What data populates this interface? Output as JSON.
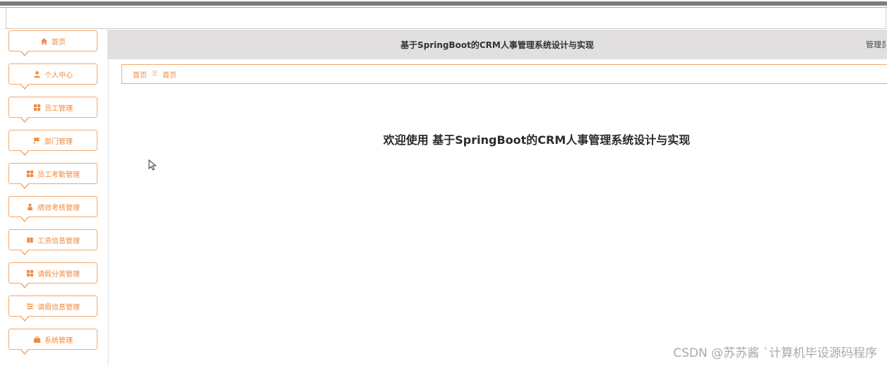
{
  "sidebar": {
    "items": [
      {
        "label": "首页",
        "icon": "home-icon"
      },
      {
        "label": "个人中心",
        "icon": "user-icon"
      },
      {
        "label": "员工管理",
        "icon": "grid-icon"
      },
      {
        "label": "部门管理",
        "icon": "flag-icon"
      },
      {
        "label": "员工考勤管理",
        "icon": "grid-icon"
      },
      {
        "label": "绩效考核管理",
        "icon": "person-icon"
      },
      {
        "label": "工资信息管理",
        "icon": "book-icon"
      },
      {
        "label": "请假分类管理",
        "icon": "grid-icon"
      },
      {
        "label": "请假信息管理",
        "icon": "sliders-icon"
      },
      {
        "label": "系统管理",
        "icon": "briefcase-icon"
      }
    ]
  },
  "header": {
    "title": "基于SpringBoot的CRM人事管理系统设计与实现",
    "user": "管理员"
  },
  "breadcrumb": {
    "home": "首页",
    "separator": "☰",
    "current": "首页"
  },
  "main": {
    "welcome": "欢迎使用 基于SpringBoot的CRM人事管理系统设计与实现"
  },
  "watermark": "CSDN @苏苏酱    ˋ计算机毕设源码程序",
  "colors": {
    "accent": "#f08a3c",
    "header_bg": "#e1dfe0"
  }
}
